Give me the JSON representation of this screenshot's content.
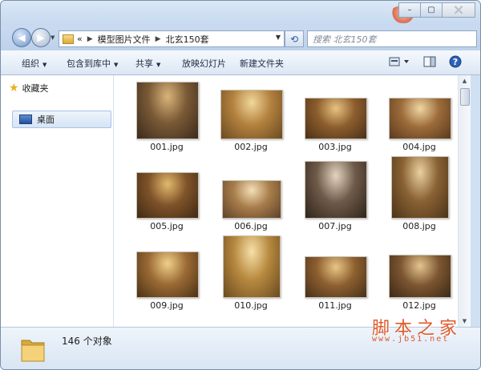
{
  "addressbar": {
    "overflow": "«",
    "crumbs": [
      "模型图片文件",
      "北玄150套"
    ]
  },
  "search": {
    "placeholder": "搜索 北玄150套"
  },
  "toolbar": {
    "organize": "组织",
    "include_in_library": "包含到库中",
    "share": "共享",
    "slideshow": "放映幻灯片",
    "new_folder": "新建文件夹"
  },
  "sidebar": {
    "favorites": "收藏夹",
    "desktop": "桌面"
  },
  "files": [
    {
      "name": "001.jpg",
      "colors": [
        "#7a5a36",
        "#d9b47a",
        "#3b2a1c"
      ]
    },
    {
      "name": "002.jpg",
      "colors": [
        "#b3813e",
        "#f1d79c",
        "#6b4a22"
      ]
    },
    {
      "name": "003.jpg",
      "colors": [
        "#8c5d2d",
        "#e6c280",
        "#4a3018"
      ]
    },
    {
      "name": "004.jpg",
      "colors": [
        "#9c6b3a",
        "#efd6a2",
        "#5a3a1d"
      ]
    },
    {
      "name": "005.jpg",
      "colors": [
        "#7f5329",
        "#e2b96e",
        "#3f2a14"
      ]
    },
    {
      "name": "006.jpg",
      "colors": [
        "#a87d4b",
        "#f3dfb8",
        "#5e4227"
      ]
    },
    {
      "name": "007.jpg",
      "colors": [
        "#6e5a49",
        "#e3d4c0",
        "#2f241b"
      ]
    },
    {
      "name": "008.jpg",
      "colors": [
        "#8a6233",
        "#ead0a0",
        "#4b331a"
      ]
    },
    {
      "name": "009.jpg",
      "colors": [
        "#9a6a34",
        "#f0d08a",
        "#4c3116"
      ]
    },
    {
      "name": "010.jpg",
      "colors": [
        "#b7893f",
        "#f6e0a8",
        "#6a4a1f"
      ]
    },
    {
      "name": "011.jpg",
      "colors": [
        "#8d5f2f",
        "#e8c586",
        "#46301a"
      ]
    },
    {
      "name": "012.jpg",
      "colors": [
        "#7c5631",
        "#e4c48e",
        "#3c2816"
      ]
    },
    {
      "name": "",
      "colors": [
        "#c9a46a",
        "#f4e3bf",
        "#8a6a3e"
      ]
    }
  ],
  "status": {
    "count": "146 个对象"
  },
  "watermark": {
    "line1": "脚本之家",
    "line2": "www.jb51.net"
  }
}
